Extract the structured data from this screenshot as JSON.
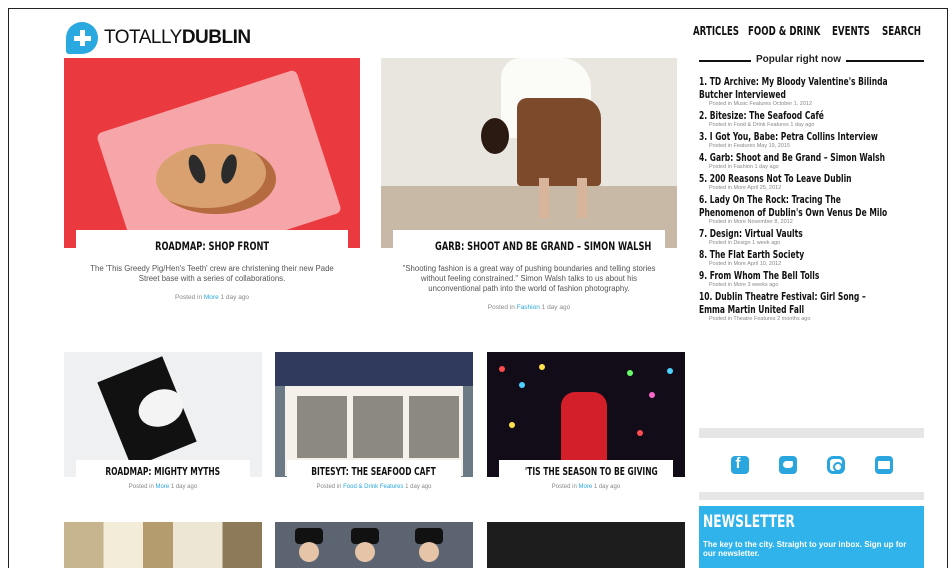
{
  "brand": {
    "name_light": "TOTALLY",
    "name_bold": "DUBLIN"
  },
  "nav": [
    "ARTICLES",
    "FOOD & DRINK",
    "EVENTS",
    "SEARCH"
  ],
  "features": [
    {
      "title": "ROADMAP: SHOP FRONT",
      "excerpt": "The 'This Greedy Pig/Hen's Teeth' crew are christening their new Pade Street base with a series of collaborations.",
      "meta_prefix": "Posted in ",
      "category": "More",
      "age": " 1 day ago"
    },
    {
      "title": "GARB: SHOOT AND BE GRAND – SIMON WALSH",
      "excerpt": "\"Shooting fashion is a great way of pushing boundaries and telling stories without feeling constrained.\" Simon Walsh talks to us about his unconventional path into the world of fashion photography.",
      "meta_prefix": "Posted in ",
      "category": "Fashion",
      "age": " 1 day ago"
    }
  ],
  "cards": [
    {
      "title": "ROADMAP: MIGHTY MYTHS",
      "meta_prefix": "Posted in ",
      "category": "More",
      "age": " 1 day ago"
    },
    {
      "title": "BITESYT: THE SEAFOOD CAFT",
      "meta_prefix": "Posted in ",
      "category": "Food & Drink Features",
      "age": " 1 day ago"
    },
    {
      "title": "'TIS THE SEASON TO BE GIVING",
      "meta_prefix": "Posted in ",
      "category": "More",
      "age": " 1 day ago"
    }
  ],
  "popular": {
    "heading": "Popular right now",
    "items": [
      {
        "title": "1. TD Archive: My Bloody Valentine's Bilinda Butcher Interviewed",
        "meta": "Posted in Music Features October 1, 2012"
      },
      {
        "title": "2. Bitesize: The Seafood Café",
        "meta": "Posted in Food & Drink Features 1 day ago"
      },
      {
        "title": "3. I Got You, Babe: Petra Collins Interview",
        "meta": "Posted in Features May 19, 2015"
      },
      {
        "title": "4. Garb: Shoot and Be Grand – Simon Walsh",
        "meta": "Posted in Fashion 1 day ago"
      },
      {
        "title": "5. 200 Reasons Not To Leave Dublin",
        "meta": "Posted in More April 25, 2012"
      },
      {
        "title": "6. Lady On The Rock: Tracing The Phenomenon of Dublin's Own Venus De Milo",
        "meta": "Posted in More November 8, 2012"
      },
      {
        "title": "7. Design: Virtual Vaults",
        "meta": "Posted in Design 1 week ago"
      },
      {
        "title": "8. The Flat Earth Society",
        "meta": "Posted in More April 10, 2012"
      },
      {
        "title": "9. From Whom The Bell Tolls",
        "meta": "Posted in More 3 weeks ago"
      },
      {
        "title": "10. Dublin Theatre Festival: Girl Song – Emma Martin United Fall",
        "meta": "Posted in Theatre Features 2 months ago"
      }
    ]
  },
  "social": [
    "facebook-icon",
    "twitter-icon",
    "instagram-icon",
    "email-icon"
  ],
  "newsletter": {
    "title": "NEWSLETTER",
    "text": "The key to the city. Straight to your inbox. Sign up for our newsletter."
  },
  "colors": {
    "accent": "#2aa6de",
    "newsletter_bg": "#2fb3ea"
  }
}
